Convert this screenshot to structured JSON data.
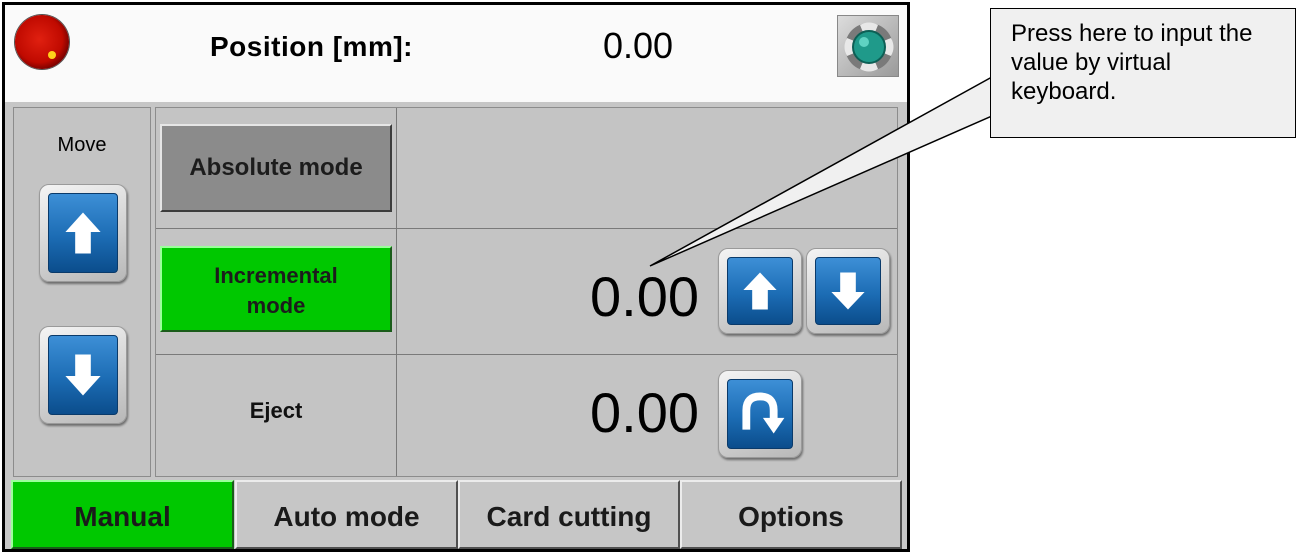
{
  "header": {
    "position_label": "Position  [mm]:",
    "position_value": "0.00",
    "stop_icon": "emergency-stop-icon",
    "fan_icon": "fan-icon"
  },
  "move_panel": {
    "label": "Move",
    "up_icon": "arrow-up-icon",
    "down_icon": "arrow-down-icon"
  },
  "modes": {
    "absolute_label": "Absolute mode",
    "incremental_label_line1": "Incremental",
    "incremental_label_line2": "mode",
    "incremental_value": "0.00",
    "eject_label": "Eject",
    "eject_value": "0.00",
    "eject_icon": "return-arrow-icon"
  },
  "tabs": [
    {
      "label": "Manual",
      "active": true
    },
    {
      "label": "Auto mode",
      "active": false
    },
    {
      "label": "Card cutting",
      "active": false
    },
    {
      "label": "Options",
      "active": false
    }
  ],
  "callout": {
    "text": "Press here to input the value by virtual keyboard."
  },
  "colors": {
    "active_green": "#00c800",
    "button_blue": "#1c6cb4",
    "panel_gray": "#c4c4c4",
    "stop_red": "#c00a00"
  }
}
